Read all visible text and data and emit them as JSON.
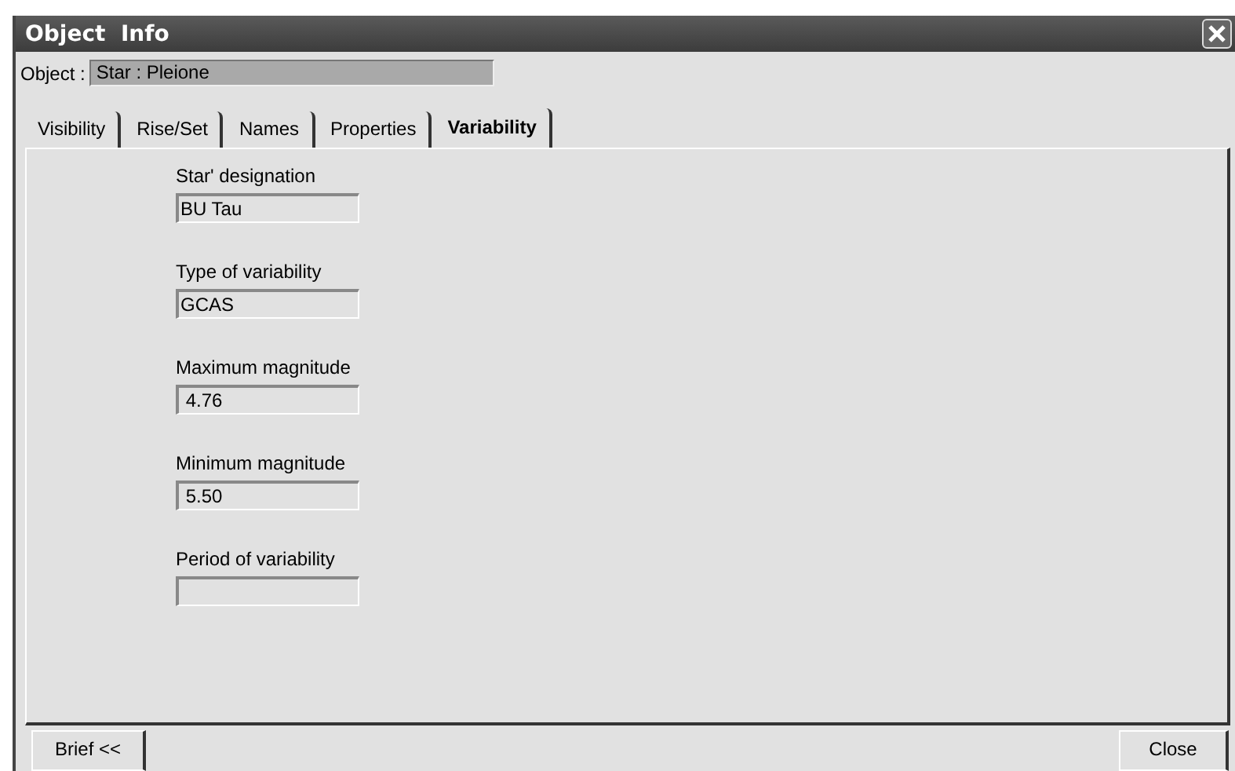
{
  "window": {
    "title": "Object  Info"
  },
  "object": {
    "label": "Object :",
    "value": "Star : Pleione"
  },
  "tabs": [
    {
      "label": "Visibility",
      "selected": false
    },
    {
      "label": "Rise/Set",
      "selected": false
    },
    {
      "label": "Names",
      "selected": false
    },
    {
      "label": "Properties",
      "selected": false
    },
    {
      "label": "Variability",
      "selected": true
    }
  ],
  "fields": [
    {
      "label": "Star' designation",
      "value": "BU Tau"
    },
    {
      "label": "Type of variability",
      "value": "GCAS"
    },
    {
      "label": "Maximum magnitude",
      "value": " 4.76"
    },
    {
      "label": "Minimum magnitude",
      "value": " 5.50"
    },
    {
      "label": "Period of variability"
    }
  ],
  "buttons": [
    {
      "label": "Brief <<"
    },
    {
      "label": "Close"
    }
  ]
}
